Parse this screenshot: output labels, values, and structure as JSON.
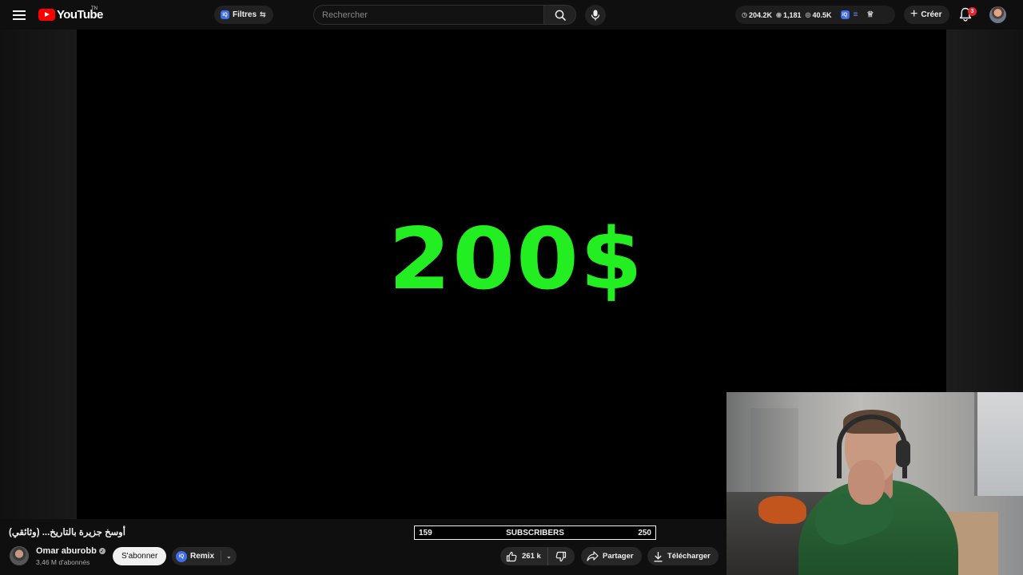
{
  "header": {
    "logo_text": "YouTube",
    "logo_tm": "TN",
    "filters_label": "Filtres",
    "search_placeholder": "Rechercher",
    "stats": [
      "204.2K",
      "1,181",
      "40.5K"
    ],
    "create_label": "Créer",
    "notification_count": "3"
  },
  "video": {
    "overlay_text": "200$",
    "overlay_color": "#22ee22",
    "title": "أوسخ جزيرة بالتاريخ... (وثائقي)"
  },
  "channel": {
    "name": "Omar aburobb",
    "subscribers": "3,46 M d'abonnés",
    "subscribe_label": "S'abonner",
    "remix_label": "Remix"
  },
  "sub_counter": {
    "left_value": "159",
    "label": "SUBSCRIBERS",
    "right_value": "250"
  },
  "actions": {
    "like_count": "261 k",
    "share_label": "Partager",
    "download_label": "Télécharger"
  }
}
